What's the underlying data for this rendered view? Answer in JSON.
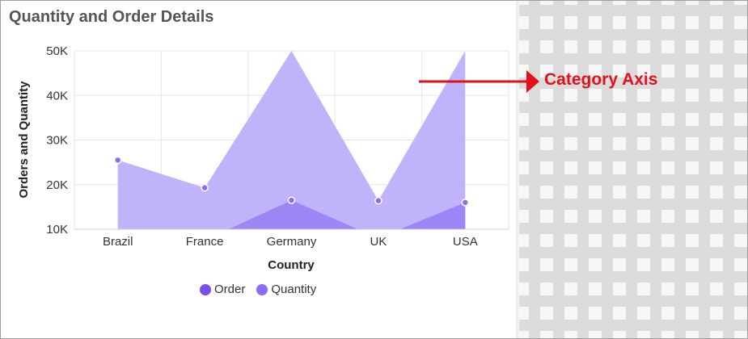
{
  "title": "Quantity and Order Details",
  "annotation": {
    "label": "Category Axis",
    "color": "#e3101a"
  },
  "legend": {
    "items": [
      {
        "label": "Order",
        "color": "#7b4fe6"
      },
      {
        "label": "Quantity",
        "color": "#8a6cf5"
      }
    ]
  },
  "colors": {
    "quantity_fill": "#bfb3fb",
    "order_fill": "#9d85f5",
    "marker_fill": "#8a6cf5",
    "grid": "#e6e6e6",
    "axis_text": "#333333"
  },
  "chart_data": {
    "type": "area",
    "title": "Quantity and Order Details",
    "xlabel": "Country",
    "ylabel": "Orders and Quantity",
    "categories": [
      "Brazil",
      "France",
      "Germany",
      "UK",
      "USA"
    ],
    "ylim": [
      10000,
      50000
    ],
    "yticks": [
      10000,
      20000,
      30000,
      40000,
      50000
    ],
    "ytick_labels": [
      "10K",
      "20K",
      "30K",
      "40K",
      "50K"
    ],
    "grid": true,
    "legend_position": "bottom",
    "series": [
      {
        "name": "Order",
        "values": [
          8000,
          7500,
          16500,
          8000,
          16000
        ]
      },
      {
        "name": "Quantity",
        "values": [
          25500,
          19300,
          50000,
          16400,
          50000
        ]
      }
    ]
  }
}
